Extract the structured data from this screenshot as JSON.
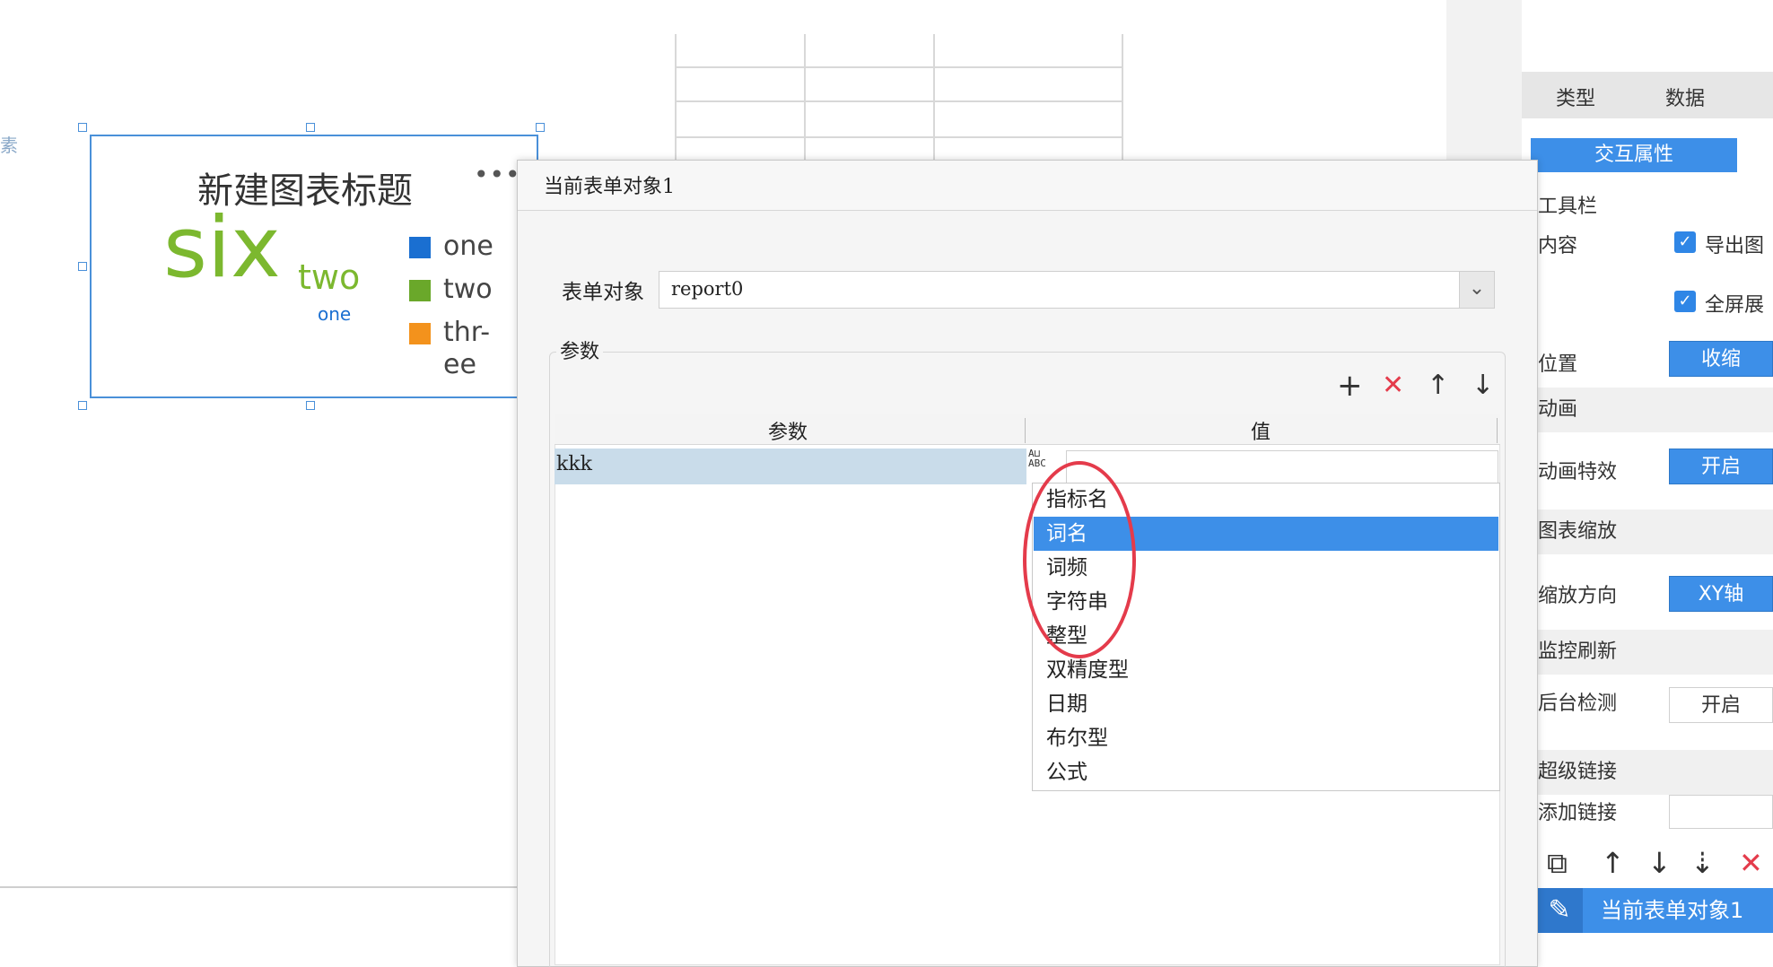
{
  "canvas": {
    "left_label": "素",
    "chart": {
      "title": "新建图表标题",
      "more": "•••",
      "words": {
        "six": "six",
        "two": "two",
        "one": "one"
      },
      "legend": [
        {
          "label": "one",
          "color": "#1a6fd1"
        },
        {
          "label": "two",
          "color": "#6aa82a"
        },
        {
          "label_line1": "thr-",
          "label_line2": "ee",
          "color": "#f3921c"
        }
      ]
    }
  },
  "dialog": {
    "title": "当前表单对象1",
    "form_object_label": "表单对象",
    "form_object_value": "report0",
    "params_legend": "参数",
    "toolbar": {
      "add": "+",
      "delete": "✕",
      "up": "↑",
      "down": "↓"
    },
    "table": {
      "headers": [
        "参数",
        "值"
      ],
      "rows": [
        {
          "param": "kkk",
          "value": ""
        }
      ]
    },
    "type_icon_text": {
      "line1": "A⊔",
      "line2": "ABC"
    },
    "dropdown": {
      "items": [
        "指标名",
        "词名",
        "词频",
        "字符串",
        "整型",
        "双精度型",
        "日期",
        "布尔型",
        "公式"
      ],
      "selected": "词名"
    }
  },
  "right_panel": {
    "tabs": [
      "类型",
      "数据"
    ],
    "interact_tab": "交互属性",
    "toolbar_section": "工具栏",
    "content_label": "内容",
    "checkbox_export": "导出图",
    "checkbox_fullscreen": "全屏展",
    "position_label": "位置",
    "position_value": "收缩",
    "animation_section": "动画",
    "animation_effect_label": "动画特效",
    "animation_effect_value": "开启",
    "zoom_section": "图表缩放",
    "zoom_dir_label": "缩放方向",
    "zoom_dir_value": "XY轴",
    "monitor_section": "监控刷新",
    "bg_detect_label": "后台检测",
    "bg_detect_value": "开启",
    "hyperlink_section": "超级链接",
    "add_link_label": "添加链接",
    "current_object": "当前表单对象1"
  }
}
